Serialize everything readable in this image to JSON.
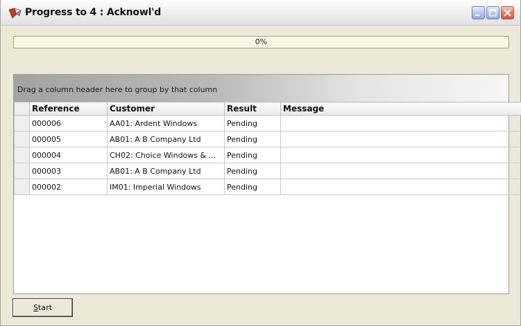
{
  "window": {
    "title": "Progress to 4 : Acknowl'd",
    "icons": [
      "app-icon",
      "minimize-icon",
      "maximize-icon",
      "close-icon"
    ]
  },
  "progress": {
    "value": 0,
    "label": "0%"
  },
  "grid": {
    "group_hint": "Drag a column header here to group by that column",
    "columns": [
      "Reference",
      "Customer",
      "Result",
      "Message"
    ],
    "rows": [
      {
        "reference": "000006",
        "customer": "AA01: Ardent Windows",
        "result": "Pending",
        "message": ""
      },
      {
        "reference": "000005",
        "customer": "AB01: A B Company Ltd",
        "result": "Pending",
        "message": ""
      },
      {
        "reference": "000004",
        "customer": "CH02: Choice Windows & ...",
        "result": "Pending",
        "message": ""
      },
      {
        "reference": "000003",
        "customer": "AB01: A B Company Ltd",
        "result": "Pending",
        "message": ""
      },
      {
        "reference": "000002",
        "customer": "IM01: Imperial Windows",
        "result": "Pending",
        "message": ""
      }
    ]
  },
  "footer": {
    "start_label_accel": "S",
    "start_label_rest": "tart"
  }
}
